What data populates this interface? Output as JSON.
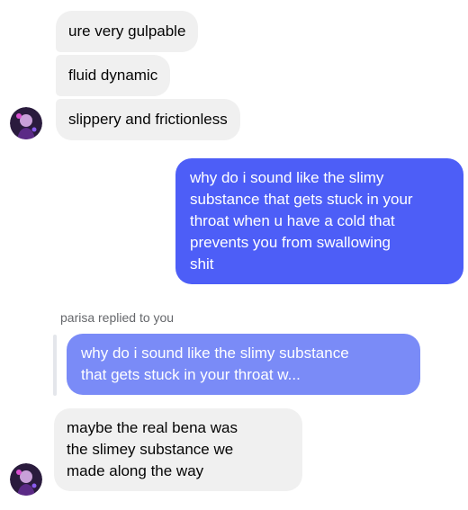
{
  "messages": [
    {
      "text": "ure very gulpable"
    },
    {
      "text": "fluid dynamic"
    },
    {
      "text": "slippery and frictionless"
    }
  ],
  "outgoing": {
    "lines": [
      "why do i sound like the slimy",
      "substance that gets stuck in your",
      "throat when u have a cold that",
      "prevents you from swallowing",
      "shit"
    ]
  },
  "reply": {
    "label": "parisa replied to you",
    "quoted_lines": [
      "why do i sound like the slimy substance",
      "that gets stuck in your throat w..."
    ],
    "response_lines": [
      "maybe the real bena was",
      "the slimey substance we",
      "made along the way"
    ]
  },
  "colors": {
    "outgoing_bubble": "#4d5ef7",
    "quoted_bubble": "#7a8bf7",
    "incoming_bubble": "#f0f0f0"
  },
  "icons": [
    "avatar"
  ]
}
